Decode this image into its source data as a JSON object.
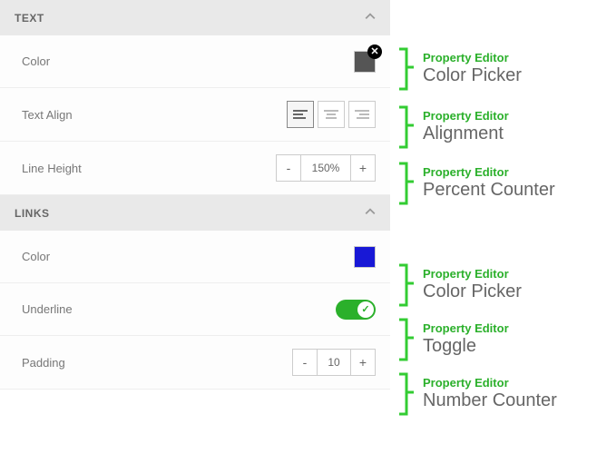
{
  "sections": {
    "text": {
      "header": "TEXT",
      "color_label": "Color",
      "color_value": "#555555",
      "align_label": "Text Align",
      "align_options": [
        "left",
        "center",
        "right"
      ],
      "align_selected": "left",
      "line_height_label": "Line Height",
      "line_height_value": "150%",
      "stepper_dec": "-",
      "stepper_inc": "+"
    },
    "links": {
      "header": "LINKS",
      "color_label": "Color",
      "color_value": "#1818d6",
      "underline_label": "Underline",
      "underline_on": true,
      "padding_label": "Padding",
      "padding_value": "10",
      "stepper_dec": "-",
      "stepper_inc": "+"
    }
  },
  "annotations": {
    "kicker": "Property Editor",
    "color_picker": "Color Picker",
    "alignment": "Alignment",
    "percent_counter": "Percent Counter",
    "toggle": "Toggle",
    "number_counter": "Number Counter"
  }
}
